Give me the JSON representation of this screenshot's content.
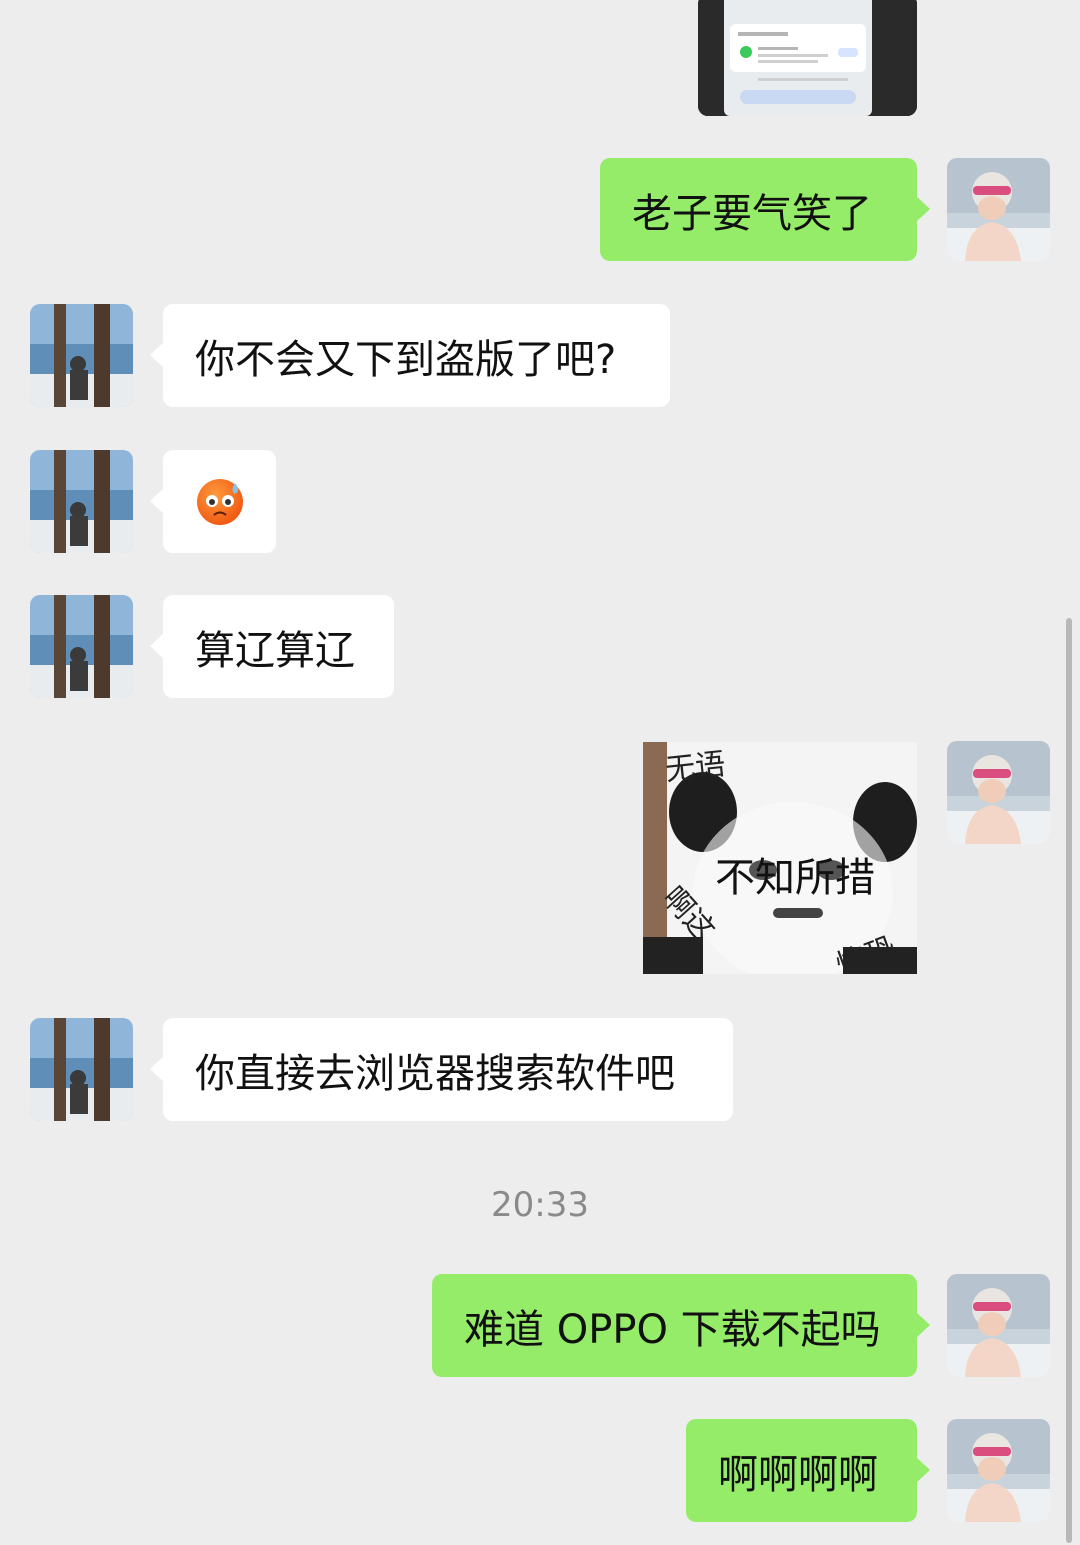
{
  "messages": [
    {
      "id": "m1",
      "side": "right",
      "type": "image",
      "image": "phone-screenshot-thumbnail"
    },
    {
      "id": "m2",
      "side": "right",
      "type": "text",
      "text": "老子要气笑了"
    },
    {
      "id": "m3",
      "side": "left",
      "type": "text",
      "text": "你不会又下到盗版了吧?"
    },
    {
      "id": "m4",
      "side": "left",
      "type": "emoji",
      "icon": "anxious-sweat-emoji"
    },
    {
      "id": "m5",
      "side": "left",
      "type": "text",
      "text": "算辽算辽"
    },
    {
      "id": "m6",
      "side": "right",
      "type": "sticker",
      "sticker": {
        "label_top": "无语",
        "label_center": "不知所措",
        "label_left": "啊这",
        "label_bottom": "惊恐"
      }
    },
    {
      "id": "m7",
      "side": "left",
      "type": "text",
      "text": "你直接去浏览器搜索软件吧"
    },
    {
      "id": "m8",
      "side": "right",
      "type": "text",
      "text": "难道 OPPO 下载不起吗"
    },
    {
      "id": "m9",
      "side": "right",
      "type": "text",
      "text": "啊啊啊啊"
    }
  ],
  "timestamp": "20:33",
  "colors": {
    "background": "#ededed",
    "outgoing_bubble": "#95ec69",
    "incoming_bubble": "#ffffff",
    "timestamp": "#8a8a8a"
  }
}
